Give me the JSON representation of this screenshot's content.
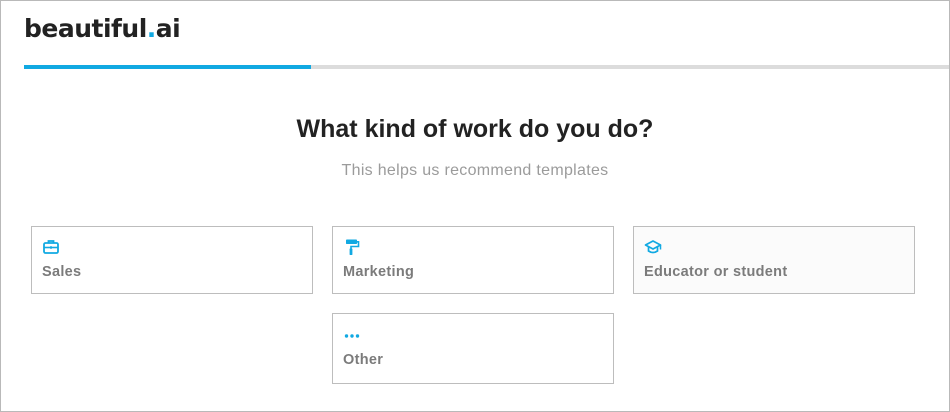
{
  "brand": {
    "name_prefix": "beautiful",
    "name_dot": ".",
    "name_suffix": "ai",
    "accent_color": "#11a9e2"
  },
  "progress": {
    "fraction": 0.31
  },
  "question": {
    "title": "What kind of work do you do?",
    "subtitle": "This helps us recommend templates"
  },
  "options": [
    {
      "label": "Sales",
      "icon": "briefcase-icon"
    },
    {
      "label": "Marketing",
      "icon": "paint-roller-icon"
    },
    {
      "label": "Educator or student",
      "icon": "graduation-cap-icon"
    },
    {
      "label": "Other",
      "icon": "more-dots-icon"
    }
  ]
}
